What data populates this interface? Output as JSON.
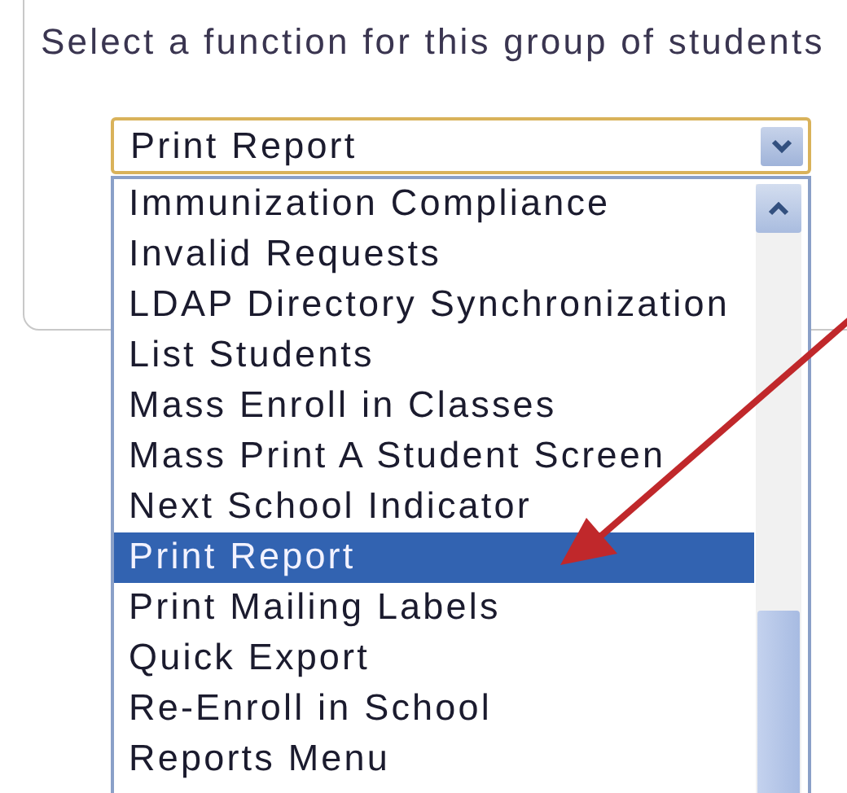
{
  "panel": {
    "heading": "Select a function for this group of students"
  },
  "select": {
    "value": "Print Report",
    "expanded": true
  },
  "options": [
    {
      "label": "Immunization Compliance",
      "selected": false
    },
    {
      "label": "Invalid Requests",
      "selected": false
    },
    {
      "label": "LDAP Directory Synchronization",
      "selected": false
    },
    {
      "label": "List Students",
      "selected": false
    },
    {
      "label": "Mass Enroll in Classes",
      "selected": false
    },
    {
      "label": "Mass Print A Student Screen",
      "selected": false
    },
    {
      "label": "Next School Indicator",
      "selected": false
    },
    {
      "label": "Print Report",
      "selected": true
    },
    {
      "label": "Print Mailing Labels",
      "selected": false
    },
    {
      "label": "Quick Export",
      "selected": false
    },
    {
      "label": "Re-Enroll in School",
      "selected": false
    },
    {
      "label": "Reports Menu",
      "selected": false
    }
  ]
}
